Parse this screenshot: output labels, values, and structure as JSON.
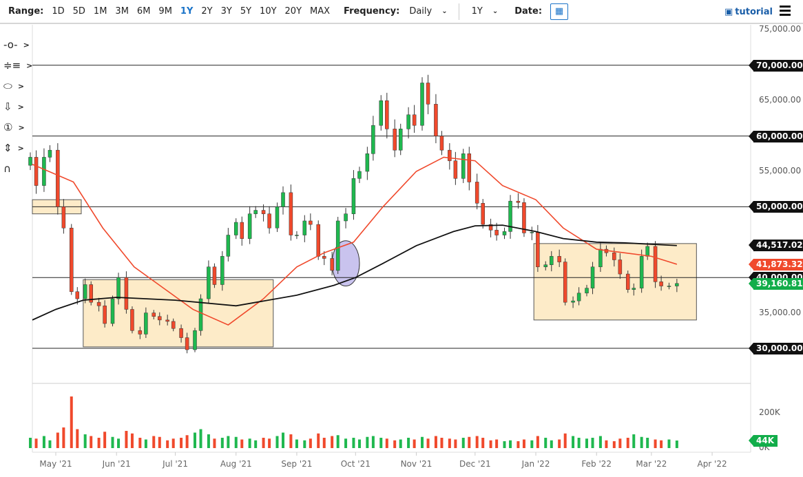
{
  "toolbar": {
    "range_label": "Range:",
    "ranges": [
      "1D",
      "5D",
      "1M",
      "3M",
      "6M",
      "9M",
      "1Y",
      "2Y",
      "3Y",
      "5Y",
      "10Y",
      "20Y",
      "MAX"
    ],
    "active_range": "1Y",
    "frequency_label": "Frequency:",
    "frequency_value": "Daily",
    "period_value": "1Y",
    "date_label": "Date:",
    "tutorial_label": "tutorial"
  },
  "chart_data": {
    "type": "candlestick",
    "start_date": "2021-04-18",
    "end_date": "2022-03-14",
    "closes": [
      57000,
      53000,
      57000,
      58000,
      50000,
      47000,
      38000,
      37000,
      39000,
      36500,
      36000,
      33500,
      37000,
      40000,
      35500,
      32500,
      32000,
      35000,
      34500,
      34000,
      33800,
      32800,
      31500,
      29800,
      32500,
      37000,
      41500,
      39000,
      43000,
      46000,
      47800,
      45500,
      49000,
      49500,
      49000,
      47000,
      50000,
      52000,
      46000,
      46000,
      48000,
      47500,
      43000,
      42700,
      41000,
      48000,
      49000,
      54000,
      55000,
      57500,
      61500,
      65000,
      61000,
      58000,
      61000,
      63000,
      61500,
      67500,
      64500,
      60000,
      58000,
      56500,
      54000,
      57500,
      53500,
      50500,
      47500,
      46700,
      46000,
      46500,
      50800,
      50600,
      46300,
      46400,
      41500,
      41800,
      43000,
      42200,
      36500,
      36700,
      37800,
      38500,
      41500,
      44000,
      43500,
      42500,
      40500,
      38300,
      38500,
      43000,
      44400,
      39400,
      38800,
      38800,
      39160.81
    ],
    "volume_k": [
      60,
      55,
      70,
      45,
      90,
      120,
      300,
      110,
      80,
      70,
      60,
      95,
      65,
      55,
      100,
      85,
      60,
      50,
      70,
      65,
      45,
      55,
      60,
      75,
      90,
      110,
      80,
      55,
      60,
      70,
      65,
      50,
      55,
      45,
      60,
      55,
      70,
      90,
      80,
      50,
      45,
      55,
      85,
      60,
      70,
      75,
      55,
      60,
      50,
      65,
      70,
      60,
      55,
      45,
      50,
      60,
      50,
      65,
      55,
      70,
      60,
      55,
      50,
      60,
      65,
      70,
      60,
      45,
      50,
      40,
      45,
      40,
      50,
      45,
      70,
      60,
      45,
      50,
      85,
      70,
      60,
      55,
      60,
      70,
      45,
      40,
      55,
      60,
      80,
      65,
      60,
      50,
      45,
      50,
      44
    ],
    "ma50": [
      [
        "2021-04-18",
        56000
      ],
      [
        "2021-05-10",
        53500
      ],
      [
        "2021-05-25",
        47000
      ],
      [
        "2021-06-10",
        41500
      ],
      [
        "2021-06-25",
        38500
      ],
      [
        "2021-07-10",
        35500
      ],
      [
        "2021-07-28",
        33300
      ],
      [
        "2021-08-15",
        37000
      ],
      [
        "2021-09-01",
        41500
      ],
      [
        "2021-09-15",
        43500
      ],
      [
        "2021-09-30",
        45000
      ],
      [
        "2021-10-15",
        50000
      ],
      [
        "2021-11-01",
        55000
      ],
      [
        "2021-11-15",
        57000
      ],
      [
        "2021-12-01",
        56500
      ],
      [
        "2021-12-15",
        53000
      ],
      [
        "2022-01-01",
        51000
      ],
      [
        "2022-01-15",
        47000
      ],
      [
        "2022-02-01",
        44000
      ],
      [
        "2022-02-15",
        43500
      ],
      [
        "2022-03-01",
        43000
      ],
      [
        "2022-03-14",
        41873.32
      ]
    ],
    "ma200": [
      [
        "2021-04-18",
        34000
      ],
      [
        "2021-05-01",
        35500
      ],
      [
        "2021-05-15",
        36800
      ],
      [
        "2021-06-01",
        37200
      ],
      [
        "2021-07-01",
        36800
      ],
      [
        "2021-08-01",
        36000
      ],
      [
        "2021-09-01",
        37500
      ],
      [
        "2021-09-20",
        38900
      ],
      [
        "2021-10-01",
        40000
      ],
      [
        "2021-10-15",
        42000
      ],
      [
        "2021-11-01",
        44500
      ],
      [
        "2021-11-20",
        46500
      ],
      [
        "2021-12-01",
        47300
      ],
      [
        "2021-12-15",
        47400
      ],
      [
        "2022-01-01",
        46500
      ],
      [
        "2022-01-15",
        45500
      ],
      [
        "2022-02-01",
        45000
      ],
      [
        "2022-02-15",
        44900
      ],
      [
        "2022-03-14",
        44517.02
      ]
    ],
    "levels": [
      70000,
      60000,
      50000,
      40000,
      30000
    ],
    "zones": [
      {
        "from": "2021-04-18",
        "to": "2021-05-14",
        "low": 49000,
        "high": 51000
      },
      {
        "from": "2021-05-15",
        "to": "2021-08-20",
        "low": 30200,
        "high": 39700
      },
      {
        "from": "2021-12-31",
        "to": "2022-03-24",
        "low": 34000,
        "high": 44800
      }
    ],
    "highlight": {
      "from": "2021-09-19",
      "to": "2021-10-03",
      "low": 38800,
      "high": 45200
    },
    "y_ticks": [
      "75,000.00",
      "65,000.00",
      "55,000.00",
      "35,000.00"
    ],
    "level_labels": [
      "70,000.00",
      "60,000.00",
      "50,000.00",
      "40,000.00",
      "30,000.00"
    ],
    "tags": {
      "ma200": "44,517.02",
      "ma50": "41,873.32",
      "level": "40,000.00",
      "last": "39,160.81",
      "volume": "44K"
    },
    "volume_ticks": [
      "200K",
      "0K"
    ],
    "x_ticks": [
      "May '21",
      "Jun '21",
      "Jul '21",
      "Aug '21",
      "Sep '21",
      "Oct '21",
      "Nov '21",
      "Dec '21",
      "Jan '22",
      "Feb '22",
      "Mar '22",
      "Apr '22"
    ],
    "x_tick_dates": [
      "2021-05-01",
      "2021-06-01",
      "2021-07-01",
      "2021-08-01",
      "2021-09-01",
      "2021-10-01",
      "2021-11-01",
      "2021-12-01",
      "2022-01-01",
      "2022-02-01",
      "2022-03-01",
      "2022-04-01"
    ],
    "colors": {
      "up": "#1fb84f",
      "down": "#f0492c",
      "ma50": "#f0492c",
      "ma200": "#111111",
      "zone": "#fdebc8",
      "highlight": "#c9c3ee"
    }
  }
}
